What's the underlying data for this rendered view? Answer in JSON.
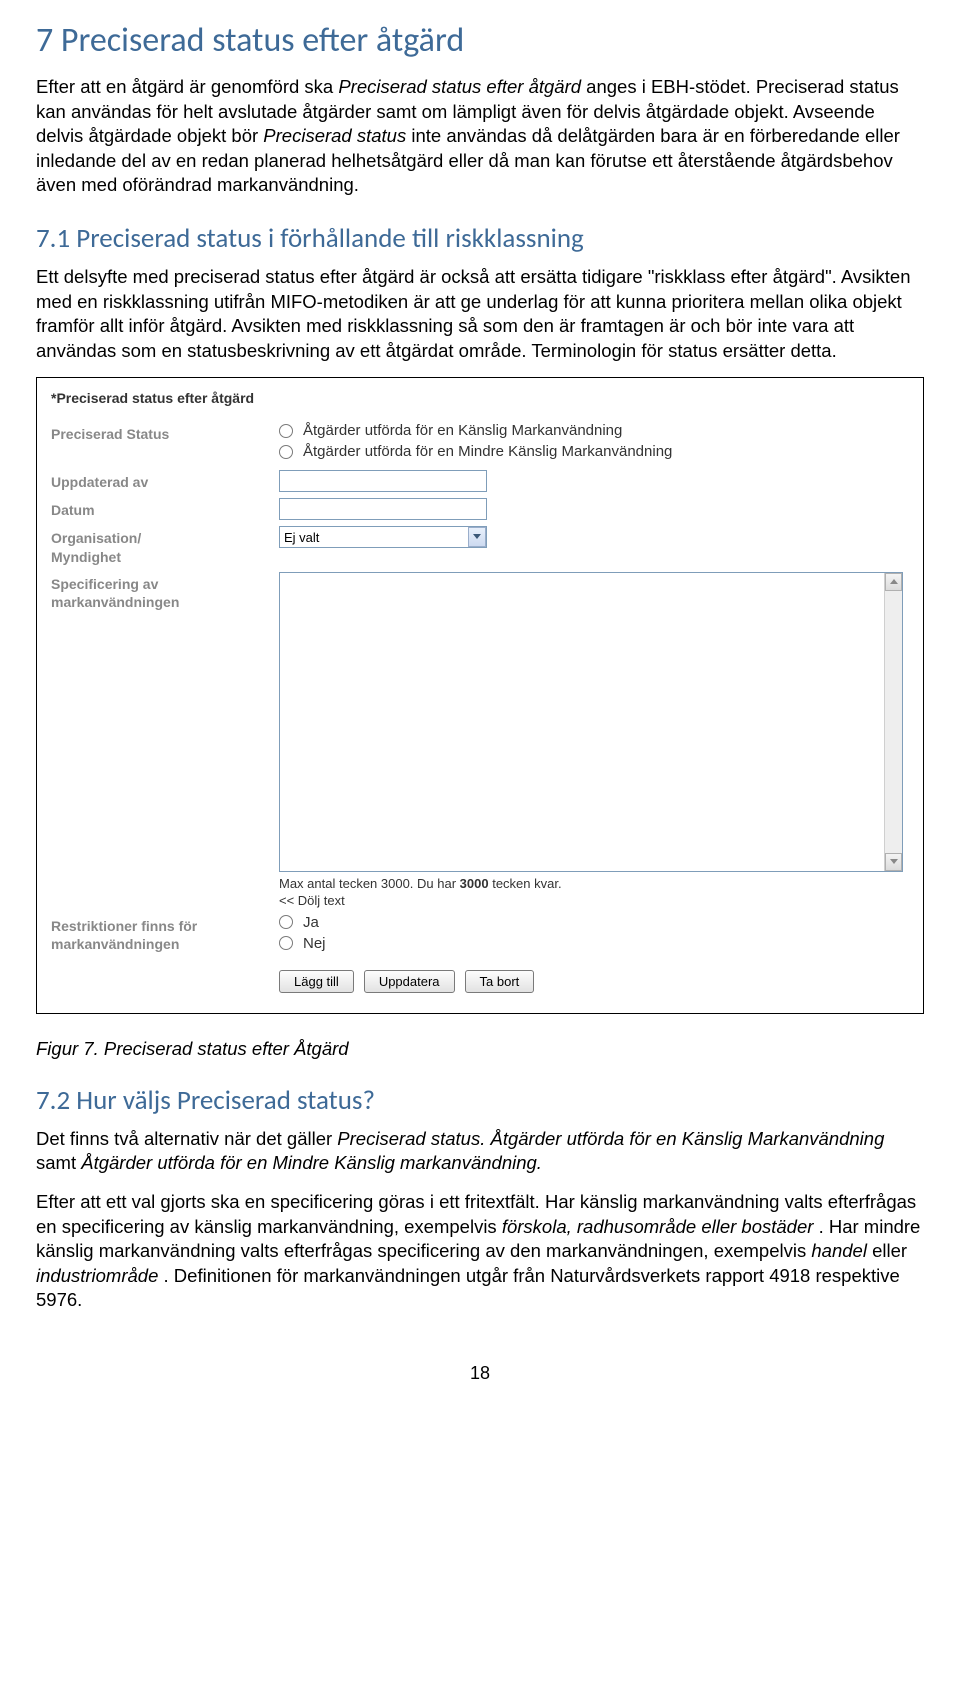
{
  "section7": {
    "heading": "7  Preciserad status efter åtgärd",
    "p1_a": "Efter att en åtgärd är genomförd ska ",
    "p1_i1": "Preciserad status efter åtgärd",
    "p1_b": " anges i EBH-stödet. Preciserad status kan användas för helt avslutade åtgärder samt om lämpligt även för delvis åtgärdade objekt. Avseende delvis åtgärdade objekt bör ",
    "p1_i2": "Preciserad status",
    "p1_c": " inte användas då delåtgärden bara är en förberedande eller inledande del av en redan planerad helhetsåtgärd eller då man kan förutse ett återstående åtgärdsbehov även med oförändrad markanvändning."
  },
  "section71": {
    "heading": "7.1  Preciserad status i förhållande till riskklassning",
    "p_a": "Ett delsyfte med preciserad status efter åtgärd är också att ersätta tidigare \"riskklass efter åtgärd\". Avsikten med en riskklassning utifrån MIFO-metodiken är att ge underlag för att kunna prioritera mellan olika objekt framför allt inför åtgärd. Avsikten med riskklassning så som den är framtagen är och bör inte vara att användas som en statusbeskrivning av ett åtgärdat område. Terminologin för status ersätter detta."
  },
  "form": {
    "title": "*Preciserad status efter åtgärd",
    "label_status": "Preciserad Status",
    "radio1": "Åtgärder utförda för en Känslig Markanvändning",
    "radio2": "Åtgärder utförda för en Mindre Känslig Markanvändning",
    "label_updated": "Uppdaterad av",
    "label_date": "Datum",
    "label_org1": "Organisation/",
    "label_org2": "Myndighet",
    "select_value": "Ej valt",
    "label_spec1": "Specificering av",
    "label_spec2": "markanvändningen",
    "hint_a": "Max antal tecken 3000. Du har ",
    "hint_bold": "3000",
    "hint_b": " tecken kvar.",
    "hide_text": "<< Dölj text",
    "label_restr1": "Restriktioner finns för",
    "label_restr2": "markanvändningen",
    "radio_yes": "Ja",
    "radio_no": "Nej",
    "btn_add": "Lägg till",
    "btn_update": "Uppdatera",
    "btn_remove": "Ta bort"
  },
  "caption": "Figur 7. Preciserad status efter Åtgärd",
  "section72": {
    "heading": "7.2  Hur väljs Preciserad status?",
    "p1_a": "Det finns två alternativ när det gäller ",
    "p1_i1": "Preciserad status. Åtgärder utförda för en Känslig Markanvändning",
    "p1_b": " samt ",
    "p1_i2": "Åtgärder utförda för en Mindre Känslig markanvändning.",
    "p2_a": "Efter att ett val gjorts ska en specificering göras i ett fritextfält. Har känslig markanvändning valts efterfrågas en specificering av känslig markanvändning, exempelvis ",
    "p2_i1": "förskola, radhusområde eller bostäder",
    "p2_b": ". Har mindre känslig markanvändning valts efterfrågas specificering av den markanvändningen, exempelvis ",
    "p2_i2": "handel",
    "p2_c": " eller ",
    "p2_i3": "industriområde",
    "p2_d": ". Definitionen för markanvändningen utgår från Naturvårdsverkets rapport 4918 respektive 5976."
  },
  "pagenum": "18"
}
